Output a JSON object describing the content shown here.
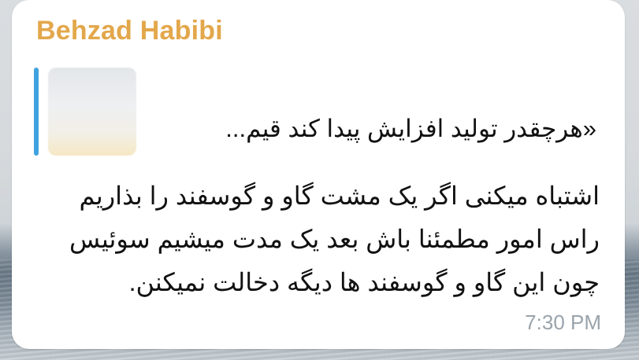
{
  "message": {
    "sender": "Behzad Habibi",
    "reply_preview": {
      "text": "«هرچقدر تولید افزایش پیدا کند قیم..."
    },
    "lines": [
      "اشتباه میکنی اگر یک مشت گاو و گوسفند را بذاریم",
      "راس امور مطمئنا باش بعد یک مدت میشیم سوئیس",
      "چون این گاو و گوسفند ها دیگه دخالت نمیکنن."
    ],
    "time": "7:30 PM"
  },
  "colors": {
    "sender_name": "#e3a74b",
    "reply_bar": "#3fa3e0",
    "timestamp": "#9aa3ab",
    "bubble": "#ffffff"
  }
}
